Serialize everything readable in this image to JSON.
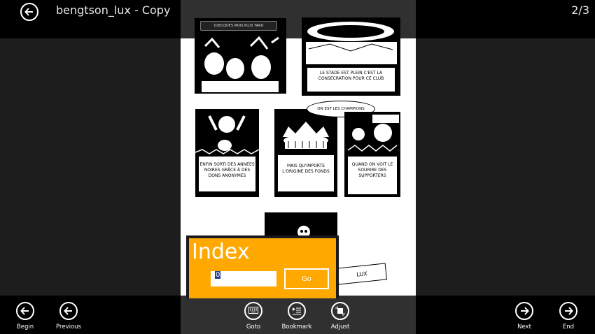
{
  "header": {
    "title": "bengtson_lux - Copy",
    "page_indicator": "2/3"
  },
  "comic": {
    "banner_text": "QUELQUES MOIS PLUS TARD",
    "caption_stadium": "LE STADE EST PLEIN C'EST LA CONSÉCRATION POUR CE CLUB",
    "bubble_champions": "ON EST LES CHAMPIONS",
    "caption_1": "ENFIN SORTI DES ANNÉES NOIRES GRÂCE À DES DONS ANONYMES",
    "caption_2": "MAIS QU'IMPORTE L'ORIGINE DES FONDS",
    "caption_3": "QUAND ON VOIT LE SOURIRE DES SUPPORTERS",
    "flag_text": "LUX"
  },
  "index_dialog": {
    "title": "Index",
    "input_value": "0",
    "go_label": "Go"
  },
  "appbar": {
    "begin": "Begin",
    "previous": "Previous",
    "goto": "Goto",
    "bookmark": "Bookmark",
    "adjust": "Adjust",
    "next": "Next",
    "end": "End"
  },
  "colors": {
    "accent": "#ffa800",
    "bar": "#000000",
    "background": "#1d1d1d"
  }
}
